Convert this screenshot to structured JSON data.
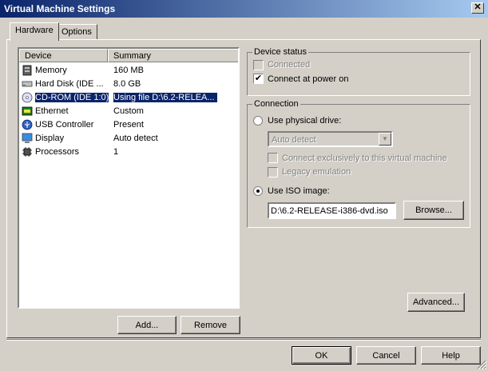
{
  "window": {
    "title": "Virtual Machine Settings",
    "close_glyph": "✕"
  },
  "tabs": [
    {
      "label": "Hardware"
    },
    {
      "label": "Options"
    }
  ],
  "device_list": {
    "columns": [
      "Device",
      "Summary"
    ],
    "rows": [
      {
        "device": "Memory",
        "summary": "160 MB",
        "icon": "memory-icon"
      },
      {
        "device": "Hard Disk (IDE ...",
        "summary": "8.0 GB",
        "icon": "hard-disk-icon"
      },
      {
        "device": "CD-ROM (IDE 1:0)",
        "summary": "Using file D:\\6.2-RELEA...",
        "icon": "cdrom-icon",
        "selected": true
      },
      {
        "device": "Ethernet",
        "summary": "Custom",
        "icon": "network-icon"
      },
      {
        "device": "USB Controller",
        "summary": "Present",
        "icon": "usb-icon"
      },
      {
        "device": "Display",
        "summary": "Auto detect",
        "icon": "display-icon"
      },
      {
        "device": "Processors",
        "summary": "1",
        "icon": "processor-icon"
      }
    ],
    "add_label": "Add...",
    "remove_label": "Remove"
  },
  "device_status": {
    "title": "Device status",
    "connected": {
      "label": "Connected",
      "checked": false,
      "disabled": true
    },
    "connect_at_power_on": {
      "label": "Connect at power on",
      "checked": true
    }
  },
  "connection": {
    "title": "Connection",
    "physical": {
      "label": "Use physical drive:",
      "checked": false
    },
    "drive_select": "Auto detect",
    "exclusive": {
      "label": "Connect exclusively to this virtual machine",
      "checked": false,
      "disabled": true
    },
    "legacy": {
      "label": "Legacy emulation",
      "checked": false,
      "disabled": true
    },
    "iso": {
      "label": "Use ISO image:",
      "checked": true
    },
    "iso_path": "D:\\6.2-RELEASE-i386-dvd.iso",
    "browse_label": "Browse..."
  },
  "advanced_label": "Advanced...",
  "footer": {
    "ok": "OK",
    "cancel": "Cancel",
    "help": "Help"
  },
  "colors": {
    "selection": "#0a246a",
    "face": "#d4d0c8"
  }
}
